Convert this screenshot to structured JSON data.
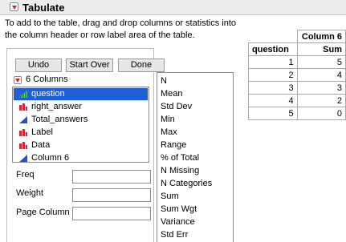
{
  "header": {
    "title": "Tabulate"
  },
  "instructions": "To add to the table, drag and drop columns or statistics into the column header or row label area of the table.",
  "buttons": {
    "undo": "Undo",
    "start_over": "Start Over",
    "done": "Done"
  },
  "columns": {
    "header": "6 Columns",
    "items": [
      {
        "label": "question",
        "type": "continuous",
        "selected": true
      },
      {
        "label": "right_answer",
        "type": "nominal"
      },
      {
        "label": "Total_answers",
        "type": "continuous"
      },
      {
        "label": "Label",
        "type": "nominal"
      },
      {
        "label": "Data",
        "type": "nominal"
      },
      {
        "label": "Column 6",
        "type": "continuous"
      }
    ]
  },
  "statistics": [
    "N",
    "Mean",
    "Std Dev",
    "Min",
    "Max",
    "Range",
    "% of Total",
    "N Missing",
    "N Categories",
    "Sum",
    "Sum Wgt",
    "Variance",
    "Std Err"
  ],
  "roles": {
    "freq": "Freq",
    "weight": "Weight",
    "page_column": "Page Column"
  },
  "table": {
    "col_header": "Column 6",
    "row_label": "question",
    "stat_header": "Sum",
    "rows": [
      {
        "question": "1",
        "sum": "5"
      },
      {
        "question": "2",
        "sum": "4"
      },
      {
        "question": "3",
        "sum": "3"
      },
      {
        "question": "4",
        "sum": "2"
      },
      {
        "question": "5",
        "sum": "0"
      }
    ]
  },
  "colors": {
    "selection": "#1e5fd7",
    "disclosure_red": "#c0282b",
    "continuous_blue": "#1e4fd8",
    "nominal_red": "#d9262c"
  }
}
